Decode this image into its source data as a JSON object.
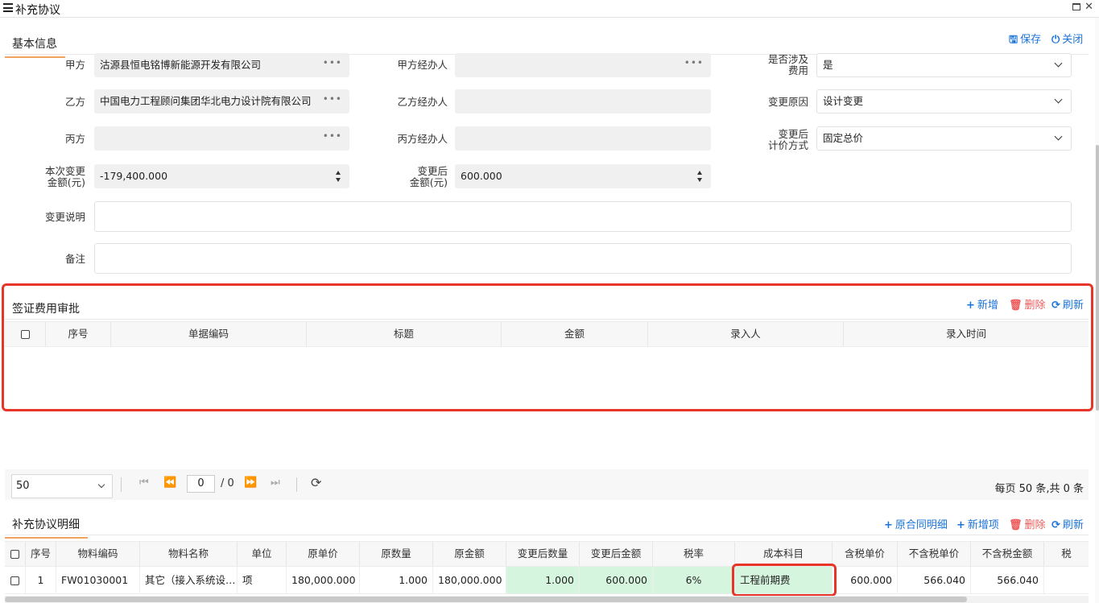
{
  "window": {
    "title": "补充协议"
  },
  "basic": {
    "section_title": "基本信息",
    "save_label": "保存",
    "close_label": "关闭",
    "party_a_label": "甲方",
    "party_a_value": "沽源县恒电铭博新能源开发有限公司",
    "party_a_agent_label": "甲方经办人",
    "party_a_agent_value": "",
    "involves_fee_label": "是否涉及\n费用",
    "involves_fee_value": "是",
    "party_b_label": "乙方",
    "party_b_value": "中国电力工程顾问集团华北电力设计院有限公司",
    "party_b_agent_label": "乙方经办人",
    "party_b_agent_value": "",
    "change_reason_label": "变更原因",
    "change_reason_value": "设计变更",
    "party_c_label": "丙方",
    "party_c_value": "",
    "party_c_agent_label": "丙方经办人",
    "party_c_agent_value": "",
    "pricing_method_label": "变更后\n计价方式",
    "pricing_method_value": "固定总价",
    "change_amount_label": "本次变更\n金额(元)",
    "change_amount_value": "-179,400.000",
    "after_amount_label": "变更后\n金额(元)",
    "after_amount_value": "600.000",
    "change_desc_label": "变更说明",
    "change_desc_value": "",
    "remark_label": "备注",
    "remark_value": ""
  },
  "visa": {
    "section_title": "签证费用审批",
    "add_label": "新增",
    "delete_label": "删除",
    "refresh_label": "刷新",
    "columns": [
      "序号",
      "单据编码",
      "标题",
      "金额",
      "录入人",
      "录入时间"
    ]
  },
  "pager": {
    "page_size": "50",
    "page_input": "0",
    "total_pages": "/ 0",
    "summary": "每页 50 条,共 0 条"
  },
  "detail": {
    "section_title": "补充协议明细",
    "contract_detail_label": "原合同明细",
    "add_item_label": "新增项",
    "delete_label": "删除",
    "refresh_label": "刷新",
    "columns": [
      "序号",
      "物料编码",
      "物料名称",
      "单位",
      "原单价",
      "原数量",
      "原金额",
      "变更后数量",
      "变更后金额",
      "税率",
      "成本科目",
      "含税单价",
      "不含税单价",
      "不含税金额",
      "税"
    ],
    "rows": [
      {
        "index": "1",
        "material_code": "FW01030001",
        "material_name": "其它（接入系统设…",
        "unit": "项",
        "orig_price": "180,000.000",
        "orig_qty": "1.000",
        "orig_amount": "180,000.000",
        "new_qty": "1.000",
        "new_amount": "600.000",
        "tax_rate": "6%",
        "cost_subject": "工程前期费",
        "price_with_tax": "600.000",
        "price_without_tax": "566.040",
        "amount_without_tax": "566.040"
      }
    ]
  },
  "colors": {
    "accent_blue": "#1a73d9",
    "delete_red": "#ef5a5a",
    "highlight_box": "#e8352a",
    "tab_underline": "#f0a35e",
    "edited_cell": "#d6f5de"
  }
}
